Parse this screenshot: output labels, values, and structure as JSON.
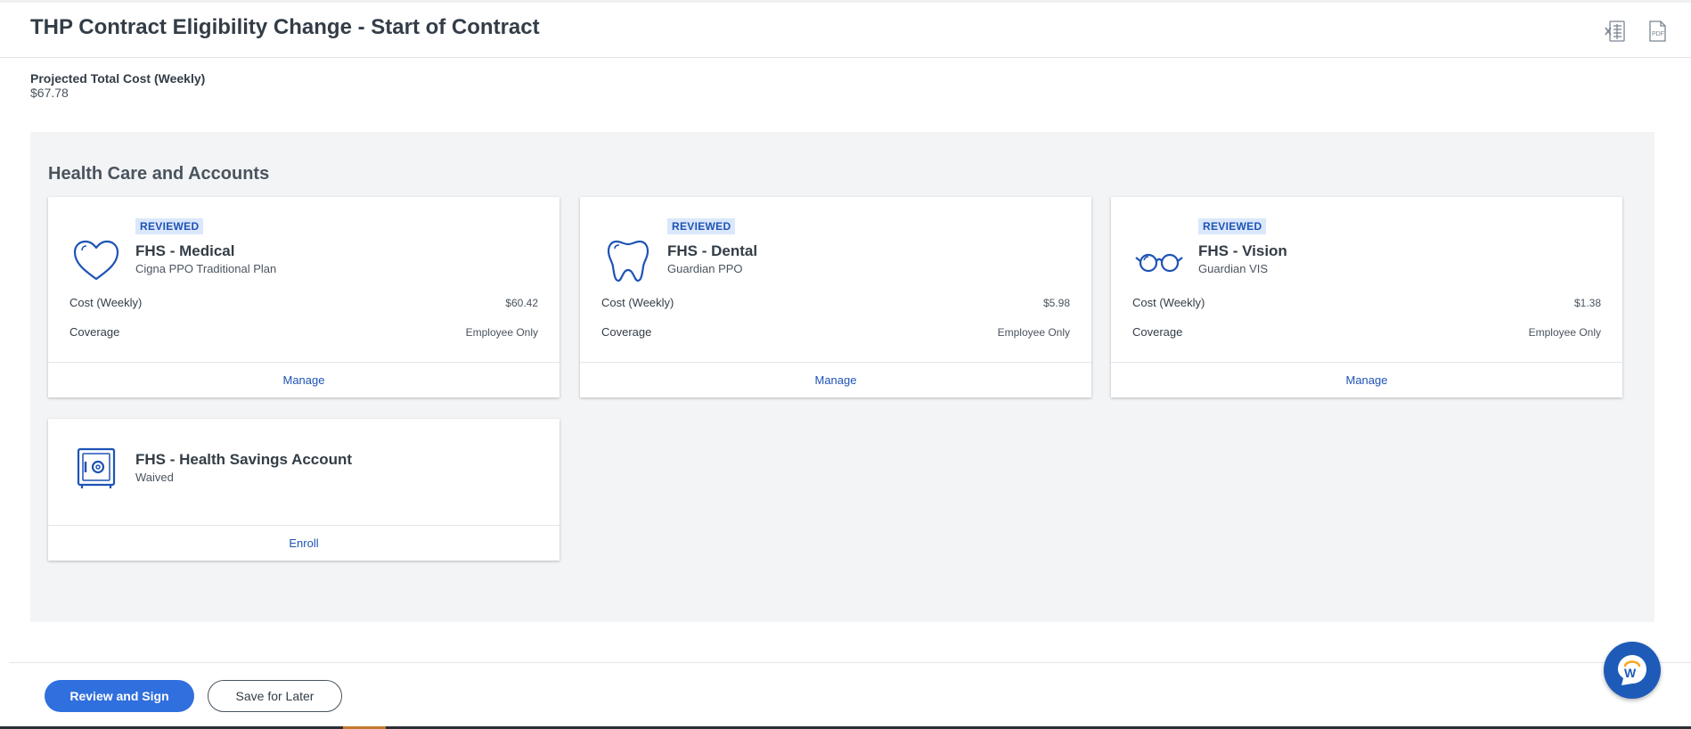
{
  "header": {
    "title": "THP Contract Eligibility Change - Start of Contract",
    "excel_icon": "excel-export-icon",
    "pdf_icon": "pdf-export-icon",
    "pdf_text": "PDF"
  },
  "summary": {
    "projected_label": "Projected Total Cost (Weekly)",
    "projected_value": "$67.78"
  },
  "section": {
    "title": "Health Care and Accounts",
    "cards": [
      {
        "icon": "heart-icon",
        "badge": "REVIEWED",
        "title": "FHS - Medical",
        "subtitle": "Cigna PPO Traditional Plan",
        "cost_label": "Cost (Weekly)",
        "cost_value": "$60.42",
        "coverage_label": "Coverage",
        "coverage_value": "Employee Only",
        "action": "Manage"
      },
      {
        "icon": "tooth-icon",
        "badge": "REVIEWED",
        "title": "FHS - Dental",
        "subtitle": "Guardian PPO",
        "cost_label": "Cost (Weekly)",
        "cost_value": "$5.98",
        "coverage_label": "Coverage",
        "coverage_value": "Employee Only",
        "action": "Manage"
      },
      {
        "icon": "glasses-icon",
        "badge": "REVIEWED",
        "title": "FHS - Vision",
        "subtitle": "Guardian VIS",
        "cost_label": "Cost (Weekly)",
        "cost_value": "$1.38",
        "coverage_label": "Coverage",
        "coverage_value": "Employee Only",
        "action": "Manage"
      },
      {
        "icon": "safe-icon",
        "title": "FHS - Health Savings Account",
        "subtitle": "Waived",
        "action": "Enroll"
      }
    ]
  },
  "footer": {
    "primary_label": "Review and Sign",
    "secondary_label": "Save for Later"
  },
  "chat": {
    "icon": "workday-chat-icon",
    "letter": "W"
  },
  "colors": {
    "accent": "#2f6fde",
    "link": "#1e53b5",
    "badge_bg": "#dbe7fb",
    "section_bg": "#f3f4f6"
  }
}
